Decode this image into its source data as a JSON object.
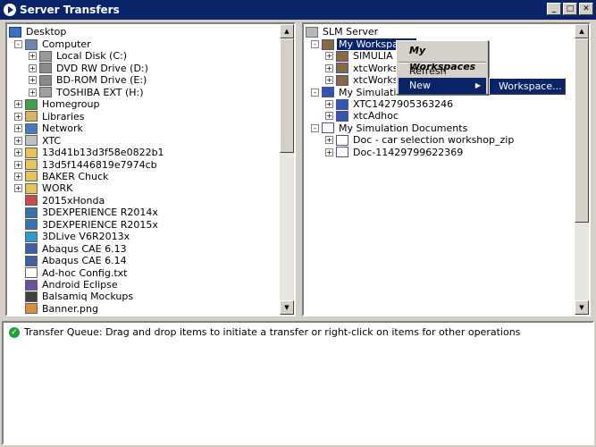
{
  "window": {
    "title": "Server Transfers",
    "buttons": {
      "minimize": "_",
      "maximize": "□",
      "close": "✕"
    }
  },
  "local_tree": {
    "root": "Desktop",
    "items": [
      {
        "label": "Computer",
        "icon": "computer-icon",
        "color": "#6f86b3"
      },
      {
        "label": "Local Disk (C:)",
        "icon": "hard-disk-icon",
        "color": "#9a9a9a"
      },
      {
        "label": "DVD RW Drive (D:)",
        "icon": "dvd-drive-icon",
        "color": "#8a8a8a"
      },
      {
        "label": "BD-ROM Drive (E:)",
        "icon": "bd-drive-icon",
        "color": "#8a8a8a"
      },
      {
        "label": "TOSHIBA EXT (H:)",
        "icon": "external-drive-icon",
        "color": "#a0a0a0"
      },
      {
        "label": "Homegroup",
        "icon": "homegroup-icon",
        "color": "#3f9f4f"
      },
      {
        "label": "Libraries",
        "icon": "libraries-icon",
        "color": "#d8b45a"
      },
      {
        "label": "Network",
        "icon": "network-icon",
        "color": "#4a78c0"
      },
      {
        "label": "XTC",
        "icon": "xtc-folder-icon",
        "color": "#c0c0c0"
      },
      {
        "label": "13d41b13d3f58e0822b1",
        "icon": "folder-icon",
        "color": "#e8c25a"
      },
      {
        "label": "13d5f1446819e7974cb",
        "icon": "folder-icon",
        "color": "#e8c25a"
      },
      {
        "label": "BAKER Chuck",
        "icon": "folder-icon",
        "color": "#e8c25a"
      },
      {
        "label": "WORK",
        "icon": "folder-icon",
        "color": "#e8c25a"
      },
      {
        "label": "2015xHonda",
        "icon": "document-icon",
        "color": "#c84a4a"
      },
      {
        "label": "3DEXPERIENCE R2014x",
        "icon": "3dexperience-icon",
        "color": "#3a6fb0"
      },
      {
        "label": "3DEXPERIENCE R2015x",
        "icon": "3dexperience-icon",
        "color": "#3a6fb0"
      },
      {
        "label": "3DLive V6R2013x",
        "icon": "3dlive-icon",
        "color": "#2e9ad0"
      },
      {
        "label": "Abaqus CAE 6.13",
        "icon": "abaqus-icon",
        "color": "#3b5fa8"
      },
      {
        "label": "Abaqus CAE 6.14",
        "icon": "abaqus-icon",
        "color": "#3b5fa8"
      },
      {
        "label": "Ad-hoc Config.txt",
        "icon": "text-file-icon",
        "color": "#ffffff"
      },
      {
        "label": "Android Eclipse",
        "icon": "android-eclipse-icon",
        "color": "#6b4fa0"
      },
      {
        "label": "Balsamiq Mockups",
        "icon": "balsamiq-icon",
        "color": "#404040"
      },
      {
        "label": "Banner.png",
        "icon": "image-file-icon",
        "color": "#d89040"
      }
    ]
  },
  "server_tree": {
    "root": "SLM Server",
    "items": [
      {
        "label": "My Workspaces",
        "icon": "workspaces-icon",
        "selected": true
      },
      {
        "label": "SIMULIA Sa",
        "icon": "workspace-icon"
      },
      {
        "label": "xtcWorkspa",
        "icon": "workspace-icon"
      },
      {
        "label": "xtcWorkspa",
        "icon": "workspace-icon"
      },
      {
        "label": "My Simulations",
        "icon": "simulations-icon"
      },
      {
        "label": "XTC1427905363246",
        "icon": "simulation-icon"
      },
      {
        "label": "xtcAdhoc",
        "icon": "simulation-icon"
      },
      {
        "label": "My Simulation Documents",
        "icon": "documents-icon"
      },
      {
        "label": "Doc - car selection workshop_zip",
        "icon": "document-icon"
      },
      {
        "label": "Doc-11429799622369",
        "icon": "document-icon"
      }
    ]
  },
  "context_menu": {
    "header": "My Workspaces",
    "refresh": "Refresh",
    "new": "New",
    "submenu_arrow": "▶",
    "submenu_item": "Workspace..."
  },
  "status": {
    "message": "Transfer Queue: Drag and drop items to initiate a transfer or right-click on items for other operations"
  },
  "scroll": {
    "up_arrow": "▲",
    "down_arrow": "▼"
  },
  "colors": {
    "title_bar": "#0a246a",
    "selection": "#0a246a",
    "status_ok": "#22a03a"
  }
}
